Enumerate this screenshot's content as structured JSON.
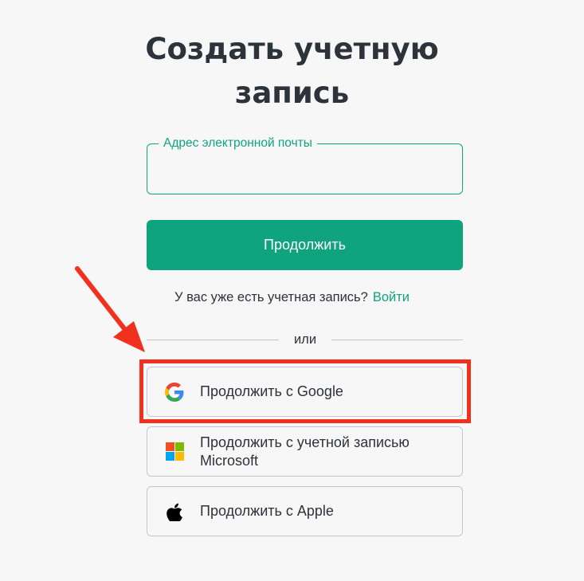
{
  "page": {
    "title_line1": "Создать учетную",
    "title_line2": "запись"
  },
  "form": {
    "email_label": "Адрес электронной почты",
    "email_value": "",
    "continue_label": "Продолжить"
  },
  "login": {
    "prompt": "У вас уже есть учетная запись?",
    "link_label": "Войти"
  },
  "divider": {
    "label": "или"
  },
  "social": {
    "google_label": "Продолжить с Google",
    "microsoft_label_line1": "Продолжить с учетной записью",
    "microsoft_label_line2": "Microsoft",
    "apple_label": "Продолжить с Apple"
  },
  "icons": {
    "google": "google-logo-icon",
    "microsoft": "microsoft-logo-icon",
    "apple": "apple-logo-icon",
    "annotation_arrow": "arrow-icon"
  },
  "colors": {
    "accent": "#10a37f",
    "annotation": "#f0311e",
    "text": "#2d333a",
    "border": "#c2c8d0",
    "background": "#f7f7f7"
  }
}
